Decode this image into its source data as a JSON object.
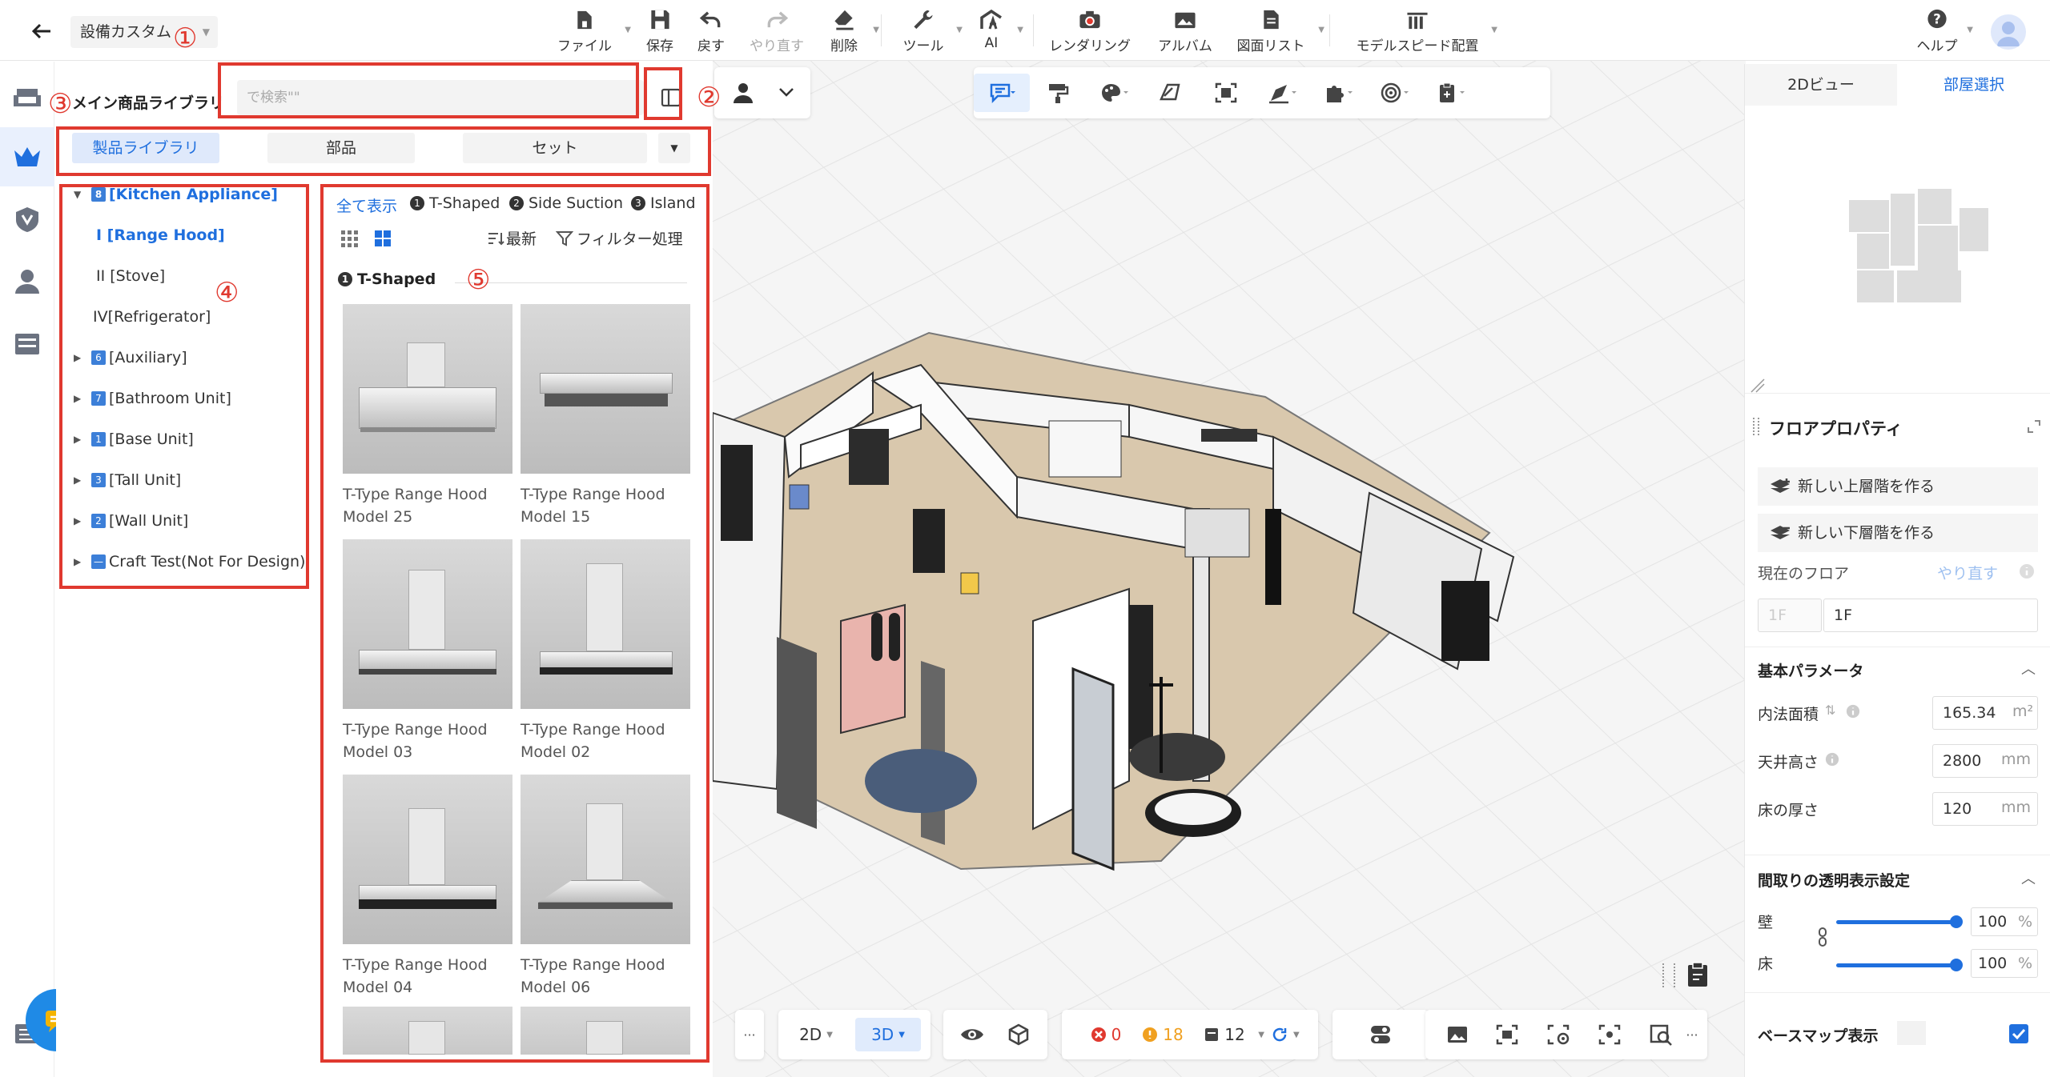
{
  "header": {
    "project_name": "設備カスタム",
    "toolbar": [
      {
        "label": "ファイル",
        "icon": "file-icon"
      },
      {
        "label": "保存",
        "icon": "save-icon"
      },
      {
        "label": "戻す",
        "icon": "undo-icon"
      },
      {
        "label": "やり直す",
        "icon": "redo-icon",
        "disabled": true
      },
      {
        "label": "削除",
        "icon": "eraser-icon"
      },
      {
        "label": "ツール",
        "icon": "wrench-icon"
      },
      {
        "label": "AI",
        "icon": "ai-icon"
      },
      {
        "label": "レンダリング",
        "icon": "camera-icon"
      },
      {
        "label": "アルバム",
        "icon": "album-icon"
      },
      {
        "label": "図面リスト",
        "icon": "drawing-list-icon"
      },
      {
        "label": "モデルスピード配置",
        "icon": "model-speed-icon"
      },
      {
        "label": "ヘルプ",
        "icon": "help-icon"
      }
    ]
  },
  "library": {
    "title": "メイン商品ライブラリ",
    "search_placeholder": "で検索\"\"",
    "tabs": [
      "製品ライブラリ",
      "部品",
      "セット"
    ],
    "tree": [
      {
        "label": "[Kitchen Appliance]",
        "badge": "8",
        "expanded": true,
        "selected": true
      },
      {
        "label": "I [Range Hood]",
        "selected": true
      },
      {
        "label": "II [Stove]"
      },
      {
        "label": "IV[Refrigerator]"
      },
      {
        "label": "[Auxiliary]",
        "badge": "6"
      },
      {
        "label": "[Bathroom Unit]",
        "badge": "7"
      },
      {
        "label": "[Base Unit]",
        "badge": "1"
      },
      {
        "label": "[Tall Unit]",
        "badge": "3"
      },
      {
        "label": "[Wall Unit]",
        "badge": "2"
      },
      {
        "label": "Craft Test(Not For Design)",
        "badge": "—"
      }
    ],
    "filters": {
      "all": "全て表示",
      "items": [
        {
          "num": "1",
          "label": "T-Shaped"
        },
        {
          "num": "2",
          "label": "Side Suction"
        },
        {
          "num": "3",
          "label": "Island"
        }
      ]
    },
    "sort_label": "最新",
    "filter_label": "フィルター処理",
    "section": {
      "num": "1",
      "label": "T-Shaped"
    },
    "products": [
      {
        "line1": "T-Type Range Hood",
        "line2": "Model 25"
      },
      {
        "line1": "T-Type Range Hood",
        "line2": "Model 15"
      },
      {
        "line1": "T-Type Range Hood",
        "line2": "Model 03"
      },
      {
        "line1": "T-Type Range Hood",
        "line2": "Model 02"
      },
      {
        "line1": "T-Type Range Hood",
        "line2": "Model 04"
      },
      {
        "line1": "T-Type Range Hood",
        "line2": "Model 06"
      }
    ]
  },
  "annotations": [
    "①",
    "②",
    "③",
    "④",
    "⑤"
  ],
  "right_panel": {
    "tabs": [
      "2Dビュー",
      "部屋選択"
    ],
    "floor_title": "フロアプロパティ",
    "new_upper": "新しい上層階を作る",
    "new_lower": "新しい下層階を作る",
    "current_floor_label": "現在のフロア",
    "redo_link": "やり直す",
    "floor_left": "1F",
    "floor_value": "1F",
    "basic_params": "基本パラメータ",
    "inner_area_label": "内法面積",
    "inner_area_value": "165.34",
    "inner_area_unit": "m²",
    "ceiling_label": "天井高さ",
    "ceiling_value": "2800",
    "ceiling_unit": "mm",
    "floor_thick_label": "床の厚さ",
    "floor_thick_value": "120",
    "floor_thick_unit": "mm",
    "transparency_title": "間取りの透明表示設定",
    "wall_label": "壁",
    "wall_value": "100",
    "floor_label": "床",
    "floor_tvalue": "100",
    "percent": "%",
    "basemap_label": "ベースマップ表示"
  },
  "bottom_bar": {
    "mode_2d": "2D",
    "mode_3d": "3D",
    "errors": "0",
    "warnings": "18",
    "items": "12",
    "more": "···"
  },
  "colors": {
    "accent": "#1f6fde",
    "annotation_red": "#e0392f",
    "error": "#e0392f",
    "warning": "#f0a020"
  }
}
